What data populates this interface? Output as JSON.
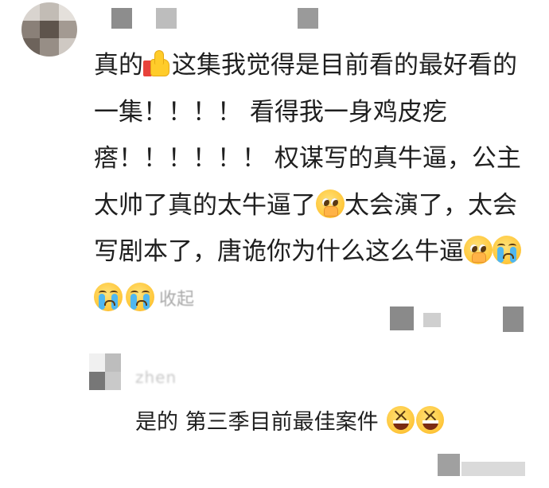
{
  "comment": {
    "username": "",
    "lines": [
      {
        "before": "真的",
        "after": "这集我觉得是目前看的最好看的"
      },
      {
        "text": "一集！！！！ 看得我一身鸡皮疙"
      },
      {
        "text": "瘩！！！！！！ 权谋写的真牛逼，公主"
      },
      {
        "before": "太帅了真的太牛逼了",
        "after": "太会演了，太会"
      },
      {
        "before": "写剧本了，唐诡你为什么这么牛逼",
        "after": ""
      }
    ],
    "collapse_label": "收起",
    "emojis": {
      "thumbs": "thumbs-up-icon",
      "pleading": "pleading-face-icon",
      "crying": "loudly-crying-face-icon",
      "laugh": "laughing-face-icon"
    }
  },
  "reply": {
    "username": "zhen",
    "text": "是的 第三季目前最佳案件"
  },
  "colors": {
    "text": "#1f1f1f",
    "muted": "#aaaaaa",
    "emoji_yellow": "#ffc83d",
    "tear_blue": "#4fb7f0"
  }
}
